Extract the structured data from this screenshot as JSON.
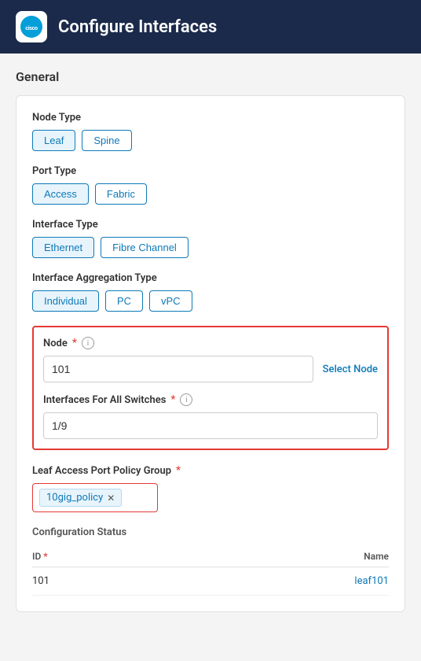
{
  "header": {
    "title": "Configure Interfaces",
    "logo_text": "cisco"
  },
  "general_section": {
    "label": "General"
  },
  "node_type": {
    "label": "Node Type",
    "options": [
      {
        "id": "leaf",
        "label": "Leaf",
        "active": true
      },
      {
        "id": "spine",
        "label": "Spine",
        "active": false
      }
    ]
  },
  "port_type": {
    "label": "Port Type",
    "options": [
      {
        "id": "access",
        "label": "Access",
        "active": true
      },
      {
        "id": "fabric",
        "label": "Fabric",
        "active": false
      }
    ]
  },
  "interface_type": {
    "label": "Interface Type",
    "options": [
      {
        "id": "ethernet",
        "label": "Ethernet",
        "active": true
      },
      {
        "id": "fibre",
        "label": "Fibre Channel",
        "active": false
      }
    ]
  },
  "aggregation_type": {
    "label": "Interface Aggregation Type",
    "options": [
      {
        "id": "individual",
        "label": "Individual",
        "active": true
      },
      {
        "id": "pc",
        "label": "PC",
        "active": false
      },
      {
        "id": "vpc",
        "label": "vPC",
        "active": false
      }
    ]
  },
  "node_field": {
    "label": "Node",
    "required": true,
    "value": "101",
    "select_link": "Select Node"
  },
  "interfaces_field": {
    "label": "Interfaces For All Switches",
    "required": true,
    "value": "1/9"
  },
  "policy_group": {
    "label": "Leaf Access Port Policy Group",
    "required": true,
    "tag_value": "10gig_policy"
  },
  "config_status": {
    "label": "Configuration Status",
    "table": {
      "columns": [
        {
          "label": "ID",
          "required": true
        },
        {
          "label": "Name",
          "required": false
        }
      ],
      "rows": [
        {
          "id": "101",
          "name": "leaf101"
        }
      ]
    }
  }
}
